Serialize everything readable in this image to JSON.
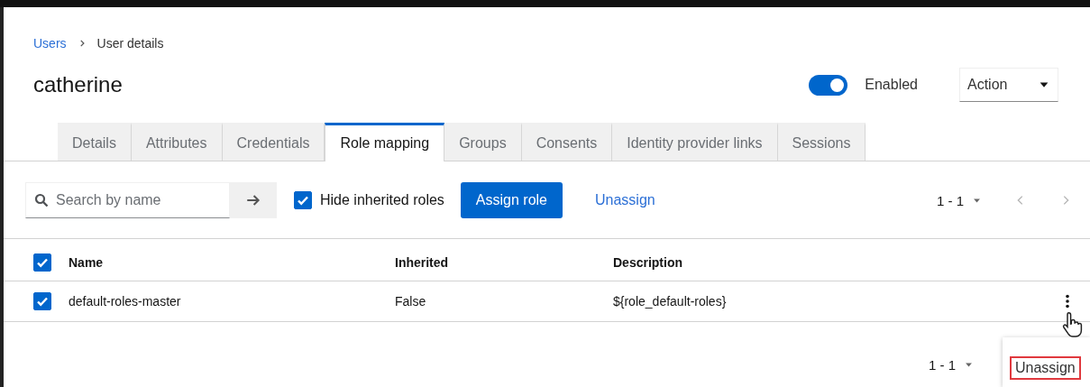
{
  "breadcrumb": [
    {
      "label": "Users",
      "kind": "link"
    },
    {
      "label": "User details",
      "kind": "current"
    }
  ],
  "user": {
    "name": "catherine",
    "enabled": true,
    "enabled_label": "Enabled"
  },
  "action_menu": {
    "label": "Action"
  },
  "tabs": [
    {
      "label": "Details",
      "selected": false
    },
    {
      "label": "Attributes",
      "selected": false
    },
    {
      "label": "Credentials",
      "selected": false
    },
    {
      "label": "Role mapping",
      "selected": true
    },
    {
      "label": "Groups",
      "selected": false
    },
    {
      "label": "Consents",
      "selected": false
    },
    {
      "label": "Identity provider links",
      "selected": false
    },
    {
      "label": "Sessions",
      "selected": false
    }
  ],
  "toolbar": {
    "search": {
      "placeholder": "Search by name"
    },
    "hide_inherited": {
      "label": "Hide inherited roles",
      "checked": true
    },
    "buttons": [
      {
        "label": "Assign role",
        "kind": "primary"
      },
      {
        "label": "Unassign",
        "kind": "link"
      }
    ],
    "pagination": "1 - 1"
  },
  "table": {
    "all_selected": true,
    "columns": [
      "Name",
      "Inherited",
      "Description"
    ],
    "rows": [
      {
        "name": "default-roles-master",
        "inherited": "False",
        "description": "${role_default-roles}",
        "selected": true
      }
    ]
  },
  "bottom_pagination": "1 - 1",
  "row_menu": {
    "items": [
      {
        "label": "Unassign",
        "highlighted": true
      }
    ]
  }
}
